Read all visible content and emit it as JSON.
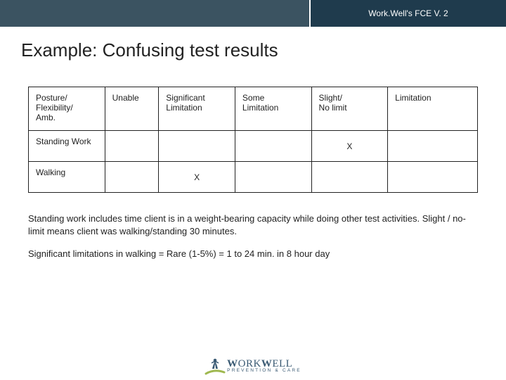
{
  "header": {
    "badge": "Work.Well's FCE V. 2"
  },
  "title": "Example:  Confusing test results",
  "table": {
    "rows": [
      {
        "c0a": "Posture/",
        "c0b": "Flexibility/",
        "c0c": "Amb.",
        "c1a": "Unable",
        "c2a": "Significant",
        "c2b": "Limitation",
        "c3a": "Some",
        "c3b": "Limitation",
        "c4a": "Slight/",
        "c4b": "No limit",
        "c5a": "Limitation"
      },
      {
        "label": "Standing Work",
        "mark_col": 4,
        "mark": "X"
      },
      {
        "label": "Walking",
        "mark_col": 2,
        "mark": "X"
      }
    ]
  },
  "paragraphs": {
    "p1": "Standing work includes time client is in a weight-bearing capacity while doing other test activities. Slight / no-limit means client was walking/standing 30 minutes.",
    "p2": "Significant limitations in walking = Rare (1-5%) = 1 to 24 min. in 8 hour day"
  },
  "logo": {
    "word1": "W",
    "word2": "ORK",
    "word3": "W",
    "word4": "ELL",
    "tagline": "PREVENTION & CARE"
  },
  "chart_data": {
    "type": "table",
    "columns": [
      "Posture/Flexibility/Amb.",
      "Unable",
      "Significant Limitation",
      "Some Limitation",
      "Slight/ No limit",
      "Limitation"
    ],
    "rows": [
      {
        "label": "Standing Work",
        "Unable": "",
        "Significant Limitation": "",
        "Some Limitation": "",
        "Slight/ No limit": "X",
        "Limitation": ""
      },
      {
        "label": "Walking",
        "Unable": "",
        "Significant Limitation": "X",
        "Some Limitation": "",
        "Slight/ No limit": "",
        "Limitation": ""
      }
    ]
  }
}
